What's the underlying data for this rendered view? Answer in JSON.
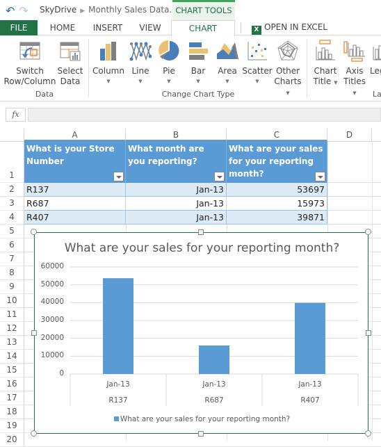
{
  "titlebar": {
    "undo_icon": "undo-icon",
    "redo_icon": "redo-icon",
    "breadcrumb_root": "SkyDrive",
    "breadcrumb_file": "Monthly Sales Data.xlsx",
    "context_tab": "CHART TOOLS"
  },
  "tabs": [
    {
      "label": "FILE"
    },
    {
      "label": "HOME"
    },
    {
      "label": "INSERT"
    },
    {
      "label": "VIEW"
    },
    {
      "label": "CHART",
      "active": true
    }
  ],
  "open_in_excel": "OPEN IN EXCEL",
  "ribbon": {
    "groups": [
      {
        "label": "Data"
      },
      {
        "label": "Change Chart Type"
      },
      {
        "label": "La"
      }
    ],
    "buttons": {
      "switch": {
        "line1": "Switch",
        "line2": "Row/Column"
      },
      "select": {
        "line1": "Select",
        "line2": "Data"
      },
      "column": {
        "line1": "Column"
      },
      "line": {
        "line1": "Line"
      },
      "pie": {
        "line1": "Pie"
      },
      "bar": {
        "line1": "Bar"
      },
      "area": {
        "line1": "Area"
      },
      "scatter": {
        "line1": "Scatter"
      },
      "other": {
        "line1": "Other",
        "line2": "Charts"
      },
      "chart_title": {
        "line1": "Chart",
        "line2": "Title"
      },
      "axis_titles": {
        "line1": "Axis",
        "line2": "Titles"
      },
      "legend": {
        "line1": "Leg"
      }
    },
    "colors": {
      "blue": "#4a7ebb",
      "gold": "#e8c172",
      "gray": "#7f7f7f",
      "orange": "#e88a3a"
    }
  },
  "formula_bar": {
    "fx_label": "fx",
    "value": ""
  },
  "sheet": {
    "columns": [
      "A",
      "B",
      "C",
      "D"
    ],
    "rows": [
      "1",
      "2",
      "3",
      "4",
      "5",
      "6",
      "7",
      "8",
      "9",
      "10",
      "11",
      "12",
      "13",
      "14",
      "15",
      "16",
      "17",
      "18",
      "19",
      "20"
    ],
    "headers": [
      "What is your Store Number",
      "What month are you reporting?",
      "What are your sales for your reporting month?"
    ],
    "data": [
      [
        "R137",
        "Jan-13",
        "53697"
      ],
      [
        "R687",
        "Jan-13",
        "15973"
      ],
      [
        "R407",
        "Jan-13",
        "39871"
      ]
    ],
    "table_color": "#5b9bd5",
    "band_color": "#ddebf7"
  },
  "chart_data": {
    "type": "bar",
    "title": "What are your sales for your reporting month?",
    "categories": [
      [
        "Jan-13",
        "R137"
      ],
      [
        "Jan-13",
        "R687"
      ],
      [
        "Jan-13",
        "R407"
      ]
    ],
    "series": [
      {
        "name": "What are your sales for your reporting month?",
        "values": [
          53697,
          15973,
          39871
        ],
        "color": "#5b9bd5"
      }
    ],
    "yticks": [
      "0",
      "10000",
      "20000",
      "30000",
      "40000",
      "50000",
      "60000"
    ],
    "ylim": [
      0,
      60000
    ],
    "grid": true,
    "legend": "bottom",
    "xlabel": "",
    "ylabel": ""
  }
}
